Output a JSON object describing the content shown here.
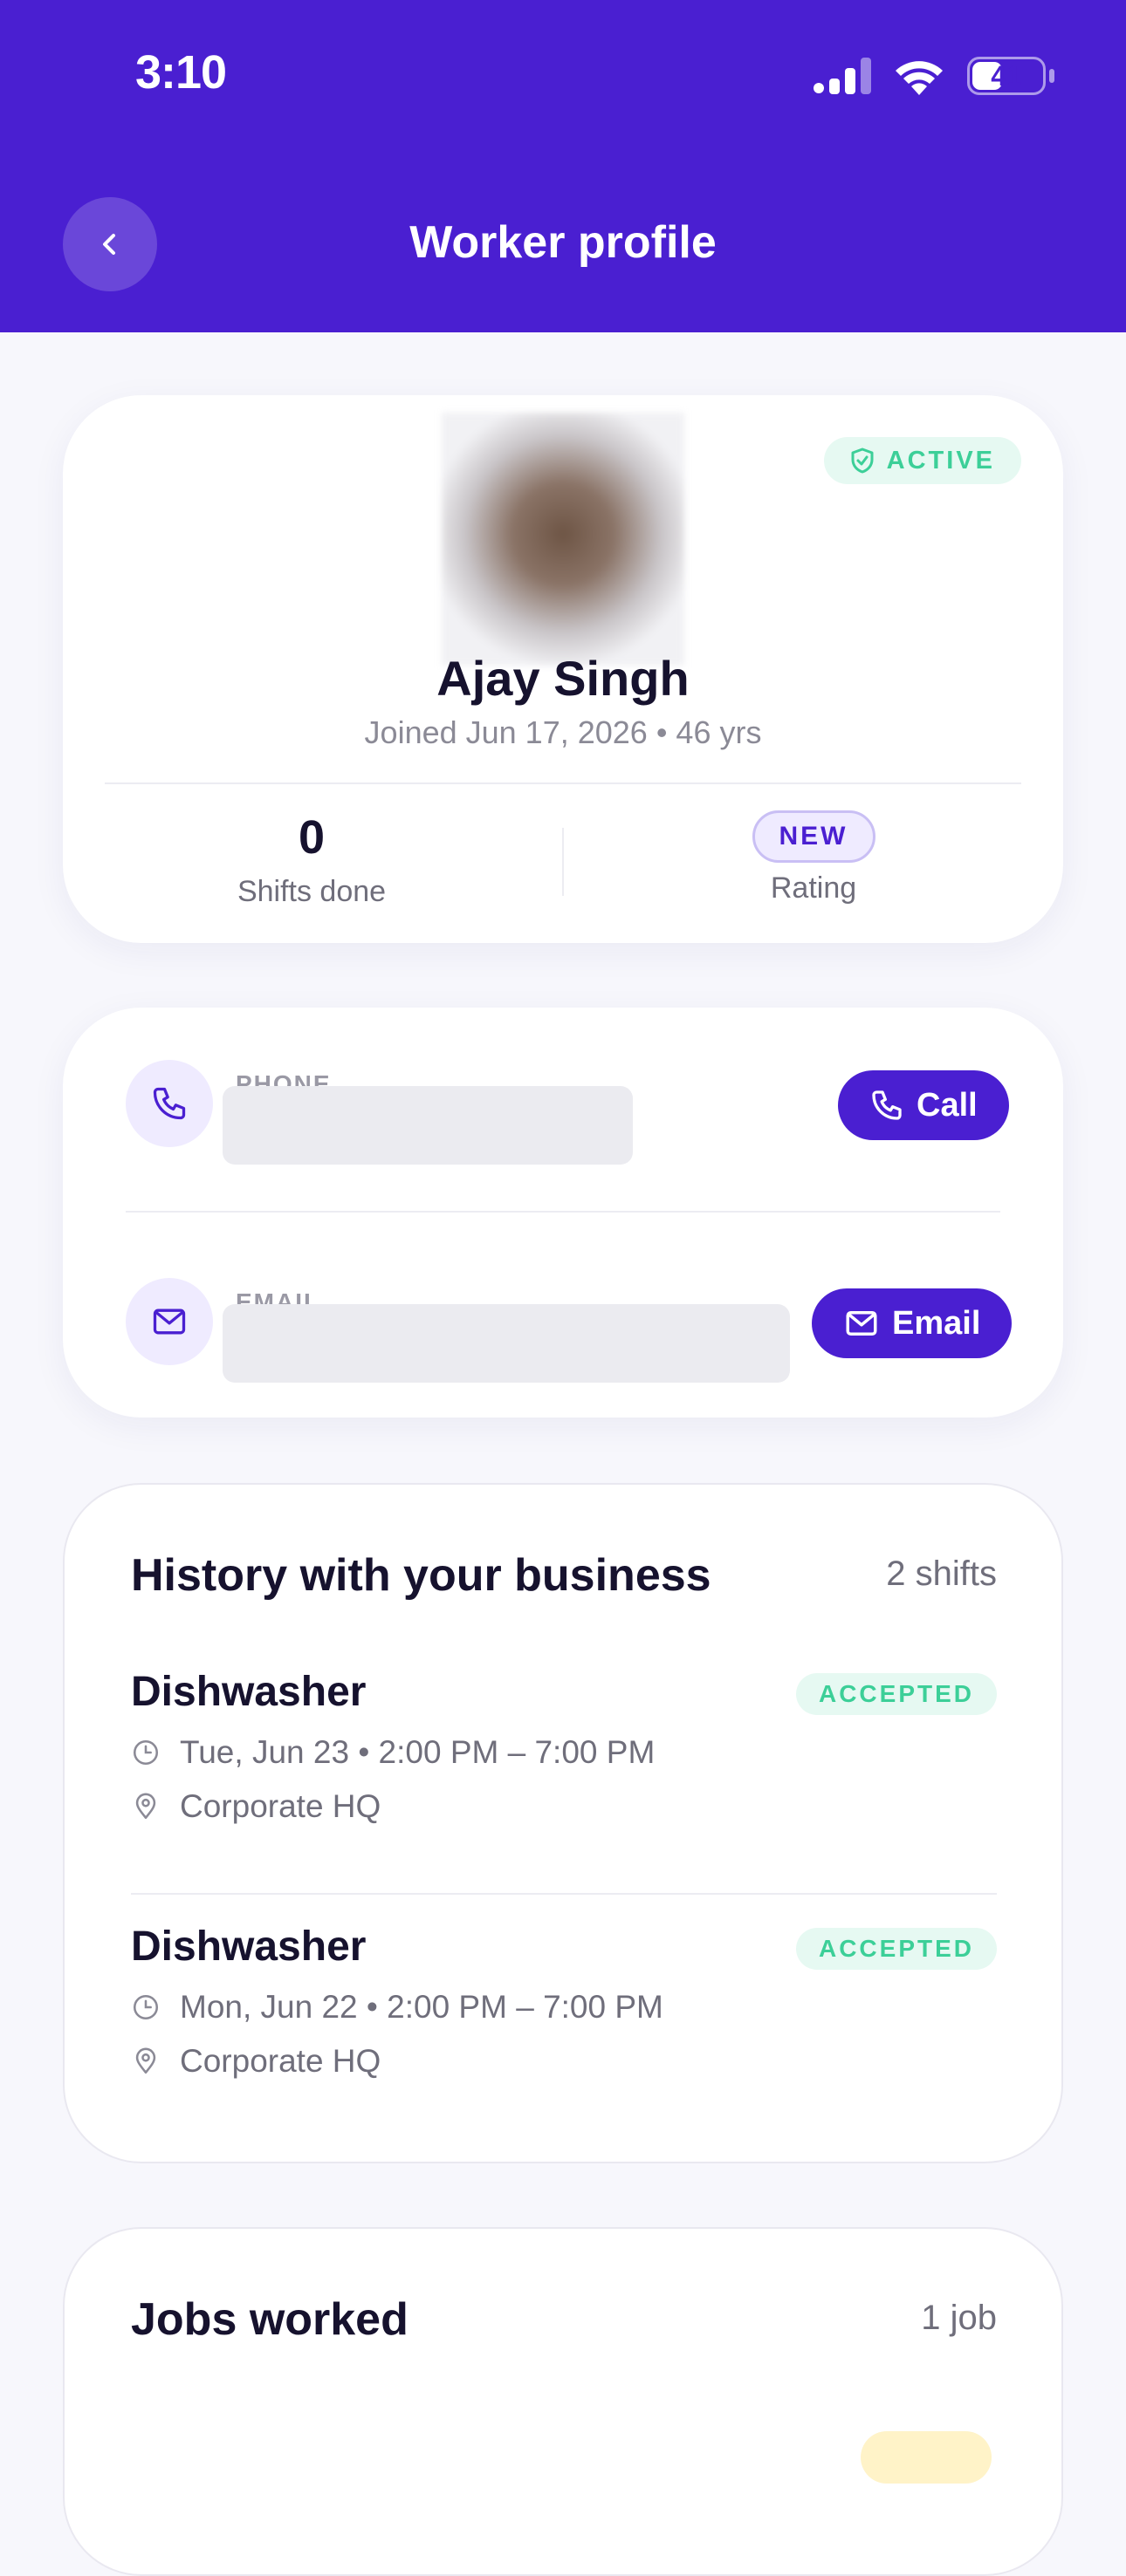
{
  "status_bar": {
    "time": "3:10",
    "battery": "41"
  },
  "header": {
    "title": "Worker profile"
  },
  "profile": {
    "status_badge": "ACTIVE",
    "name": "Ajay Singh",
    "subtitle": "Joined Jun 17, 2026 • 46 yrs",
    "shifts_done": {
      "value": "0",
      "label": "Shifts done"
    },
    "rating": {
      "value": "NEW",
      "label": "Rating"
    }
  },
  "contact": {
    "phone": {
      "label": "PHONE",
      "button": "Call"
    },
    "email": {
      "label": "EMAIL",
      "button": "Email"
    }
  },
  "history": {
    "title": "History with your business",
    "count": "2 shifts",
    "shifts": [
      {
        "role": "Dishwasher",
        "status": "ACCEPTED",
        "time": "Tue, Jun 23 • 2:00 PM – 7:00 PM",
        "location": "Corporate HQ"
      },
      {
        "role": "Dishwasher",
        "status": "ACCEPTED",
        "time": "Mon, Jun 22 • 2:00 PM – 7:00 PM",
        "location": "Corporate HQ"
      }
    ]
  },
  "jobs": {
    "title": "Jobs worked",
    "count": "1 job"
  },
  "colors": {
    "brand": "#4a1fd1",
    "success": "#3ccf98",
    "success_bg": "#e6f9f2"
  }
}
